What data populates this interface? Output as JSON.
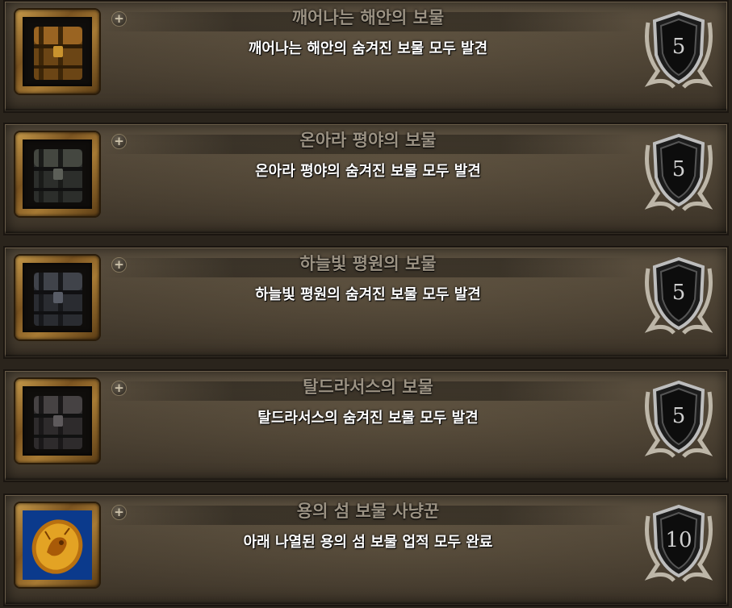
{
  "achievements": [
    {
      "title": "깨어나는 해안의 보물",
      "description": "깨어나는 해안의 숨겨진 보물 모두 발견",
      "points": "5",
      "icon": "golden-chest-icon",
      "icon_color": "#8a5a1c"
    },
    {
      "title": "온아라 평야의 보물",
      "description": "온아라 평야의 숨겨진 보물 모두 발견",
      "points": "5",
      "icon": "gray-chest-icon",
      "icon_color": "#3b3d3a"
    },
    {
      "title": "하늘빛 평원의 보물",
      "description": "하늘빛 평원의 숨겨진 보물 모두 발견",
      "points": "5",
      "icon": "gray-chest-icon",
      "icon_color": "#35383e"
    },
    {
      "title": "탈드라서스의 보물",
      "description": "탈드라서스의 숨겨진 보물 모두 발견",
      "points": "5",
      "icon": "gray-chest-icon",
      "icon_color": "#383536"
    },
    {
      "title": "용의 섬 보물 사냥꾼",
      "description": "아래 나열된 용의 섬 보물 업적 모두 완료",
      "points": "10",
      "icon": "dragon-coin-icon",
      "icon_color": "#e0a020"
    }
  ],
  "expand_symbol": "+"
}
